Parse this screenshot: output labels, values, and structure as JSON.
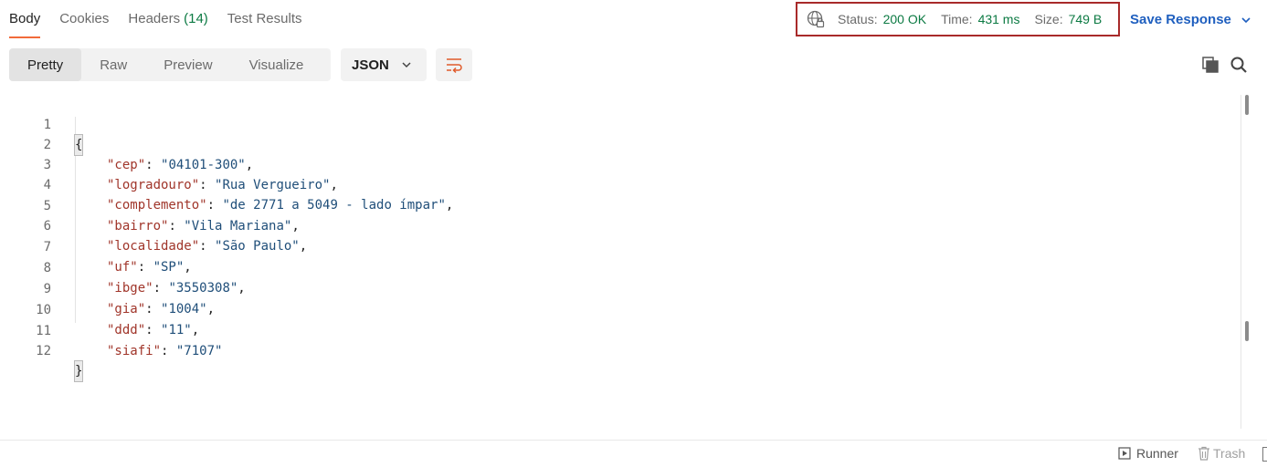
{
  "tabs": [
    {
      "label": "Body",
      "active": true
    },
    {
      "label": "Cookies"
    },
    {
      "label": "Headers",
      "count": "(14)"
    },
    {
      "label": "Test Results"
    }
  ],
  "status": {
    "status_label": "Status:",
    "status_value": "200 OK",
    "time_label": "Time:",
    "time_value": "431 ms",
    "size_label": "Size:",
    "size_value": "749 B"
  },
  "save_response": "Save Response",
  "format_modes": [
    "Pretty",
    "Raw",
    "Preview",
    "Visualize"
  ],
  "active_format": "Pretty",
  "language": "JSON",
  "code_lines": [
    {
      "n": "1"
    },
    {
      "n": "2",
      "key": "\"cep\"",
      "value": "\"04101-300\"",
      "comma": ","
    },
    {
      "n": "3",
      "key": "\"logradouro\"",
      "value": "\"Rua Vergueiro\"",
      "comma": ","
    },
    {
      "n": "4",
      "key": "\"complemento\"",
      "value": "\"de 2771 a 5049 - lado ímpar\"",
      "comma": ","
    },
    {
      "n": "5",
      "key": "\"bairro\"",
      "value": "\"Vila Mariana\"",
      "comma": ","
    },
    {
      "n": "6",
      "key": "\"localidade\"",
      "value": "\"São Paulo\"",
      "comma": ","
    },
    {
      "n": "7",
      "key": "\"uf\"",
      "value": "\"SP\"",
      "comma": ","
    },
    {
      "n": "8",
      "key": "\"ibge\"",
      "value": "\"3550308\"",
      "comma": ","
    },
    {
      "n": "9",
      "key": "\"gia\"",
      "value": "\"1004\"",
      "comma": ","
    },
    {
      "n": "10",
      "key": "\"ddd\"",
      "value": "\"11\"",
      "comma": ","
    },
    {
      "n": "11",
      "key": "\"siafi\"",
      "value": "\"7107\"",
      "comma": ""
    },
    {
      "n": "12"
    }
  ],
  "open_brace": "{",
  "close_brace": "}",
  "footer": {
    "runner": "Runner",
    "trash": "Trash"
  },
  "colors": {
    "accent": "#f26b3a",
    "status_ok": "#0c7a43",
    "link": "#1f5fbf",
    "highlight_border": "#a82a2a"
  }
}
